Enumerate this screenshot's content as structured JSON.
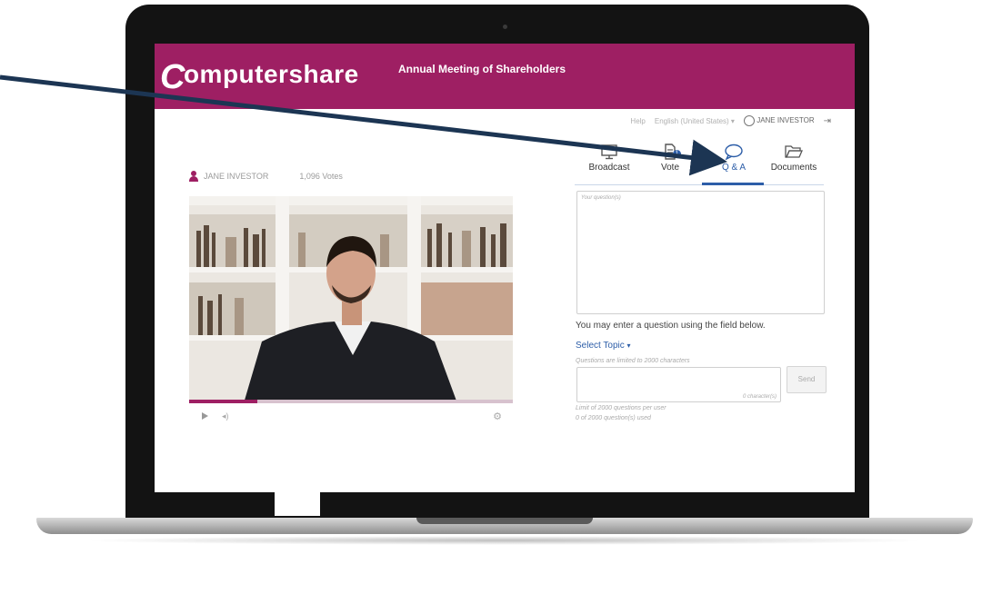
{
  "header": {
    "logo_text": "omputershare",
    "logo_mark": "C",
    "meeting_title": "Annual Meeting of Shareholders",
    "brand_color": "#9e1f63"
  },
  "util_bar": {
    "help": "Help",
    "language": "English (United States)",
    "user": "JANE INVESTOR"
  },
  "player": {
    "user_name": "JANE INVESTOR",
    "votes": "1,096 Votes",
    "progress_percent": 21
  },
  "tabs": [
    {
      "label": "Broadcast",
      "icon": "monitor-icon"
    },
    {
      "label": "Vote",
      "icon": "ballot-icon",
      "badge": "1"
    },
    {
      "label": "Q & A",
      "icon": "speech-bubble-icon",
      "active": true
    },
    {
      "label": "Documents",
      "icon": "folder-icon"
    }
  ],
  "qa": {
    "question_placeholder": "Your question(s)",
    "instructions": "You may enter a question using the field below.",
    "select_topic": "Select Topic",
    "limit_note": "Questions are limited to 2000  characters",
    "char_count": "0 character(s)",
    "send_label": "Send",
    "limit_per_user": "Limit of 2000 questions per user",
    "questions_used": "0 of 2000 question(s) used"
  },
  "colors": {
    "accent": "#2d5ea8",
    "arrow": "#1c3553"
  }
}
